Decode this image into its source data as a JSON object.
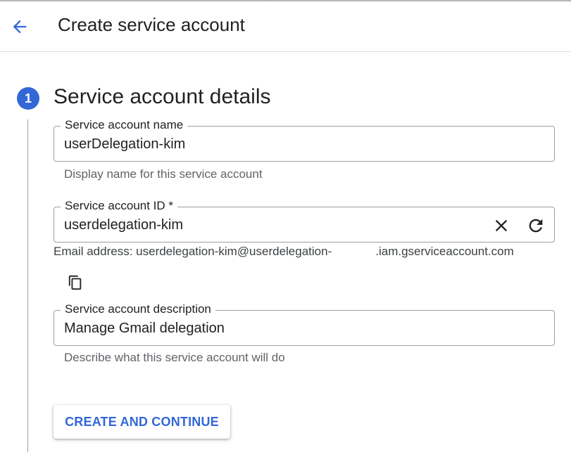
{
  "header": {
    "title": "Create service account",
    "back_icon": "arrow-left-icon"
  },
  "step": {
    "number": "1",
    "title": "Service account details",
    "accent": "#3367d6"
  },
  "fields": {
    "name": {
      "label": "Service account name",
      "value": "userDelegation-kim",
      "helper": "Display name for this service account"
    },
    "id": {
      "label": "Service account ID *",
      "value": "userdelegation-kim",
      "clear_icon": "close-icon",
      "refresh_icon": "refresh-icon"
    },
    "email": {
      "prefix": "Email address: userdelegation-kim@userdelegation-",
      "suffix": ".iam.gserviceaccount.com",
      "copy_icon": "copy-icon"
    },
    "description": {
      "label": "Service account description",
      "value": "Manage Gmail delegation",
      "helper": "Describe what this service account will do"
    }
  },
  "actions": {
    "create_label": "CREATE AND CONTINUE"
  }
}
